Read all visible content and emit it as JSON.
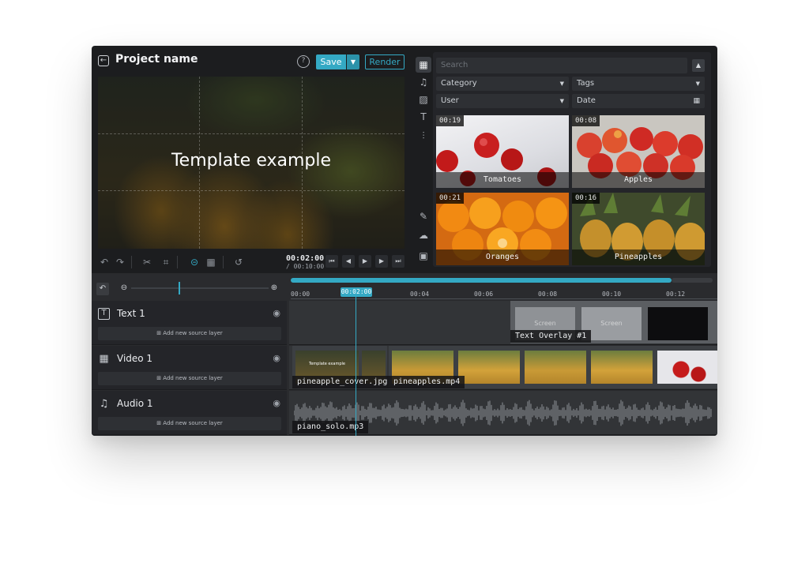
{
  "header": {
    "project_name": "Project name",
    "help_icon": "?",
    "save_label": "Save",
    "render_label": "Render"
  },
  "preview": {
    "overlay_text": "Template example",
    "time_current": "00:02:00",
    "time_total": "/ 00:10:00"
  },
  "library": {
    "search_placeholder": "Search",
    "filters": {
      "category": "Category",
      "tags": "Tags",
      "user": "User",
      "date": "Date"
    },
    "items": [
      {
        "title": "Tomatoes",
        "duration": "00:19"
      },
      {
        "title": "Apples",
        "duration": "00:08"
      },
      {
        "title": "Oranges",
        "duration": "00:21"
      },
      {
        "title": "Pineapples",
        "duration": "00:16"
      }
    ],
    "side_icons": [
      "grid-icon",
      "music-icon",
      "image-icon",
      "text-icon",
      "sliders-icon",
      "pen-icon",
      "upload-cloud-icon",
      "export-icon"
    ]
  },
  "timeline": {
    "ticks": [
      "00:00",
      "00:02:00",
      "00:04",
      "00:06",
      "00:08",
      "00:10",
      "00:12"
    ],
    "playhead_label": "00:02:00",
    "tracks": [
      {
        "name": "Text 1",
        "add_label": "Add new source layer"
      },
      {
        "name": "Video 1",
        "add_label": "Add new source layer"
      },
      {
        "name": "Audio 1",
        "add_label": "Add new source layer"
      }
    ],
    "clips": {
      "text_overlay": "Text Overlay #1",
      "screen_label": "Screen",
      "pineapple_cover": "pineapple_cover.jpg",
      "pineapples": "pineapples.mp4",
      "audio": "piano_solo.mp3",
      "cover_caption": "Template example"
    }
  },
  "colors": {
    "accent": "#34a9c4",
    "panel": "#1c1d1f"
  }
}
